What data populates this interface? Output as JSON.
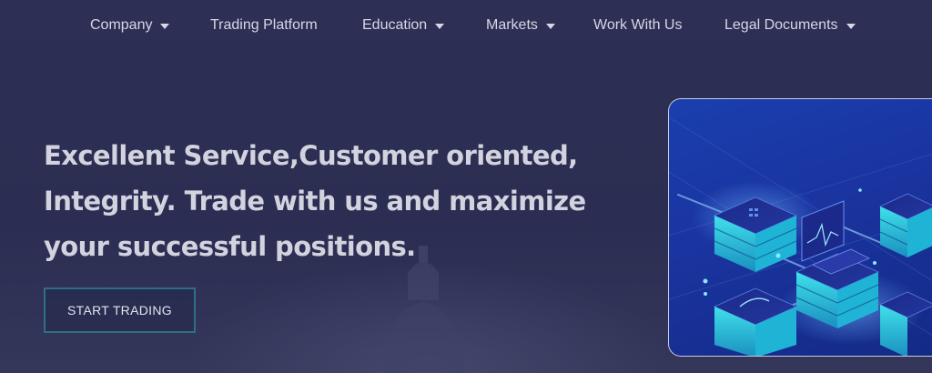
{
  "nav": {
    "items": [
      {
        "label": "Company",
        "dropdown": true
      },
      {
        "label": "Trading Platform",
        "dropdown": false
      },
      {
        "label": "Education",
        "dropdown": true
      },
      {
        "label": "Markets",
        "dropdown": true
      },
      {
        "label": "Work With Us",
        "dropdown": false
      },
      {
        "label": "Legal Documents",
        "dropdown": true
      }
    ]
  },
  "hero": {
    "title": "Excellent Service,Customer oriented, Integrity. Trade with us and maximize your successful positions.",
    "cta_label": "START TRADING"
  },
  "colors": {
    "background": "#2c2e52",
    "nav_text": "#d6d8e6",
    "hero_text": "#d2d3de",
    "cta_border": "#2e6f86",
    "illustration_blue": "#1a3fae",
    "server_cyan": "#35d6e6"
  },
  "illustration": {
    "icon": "isometric-servers-illustration"
  }
}
